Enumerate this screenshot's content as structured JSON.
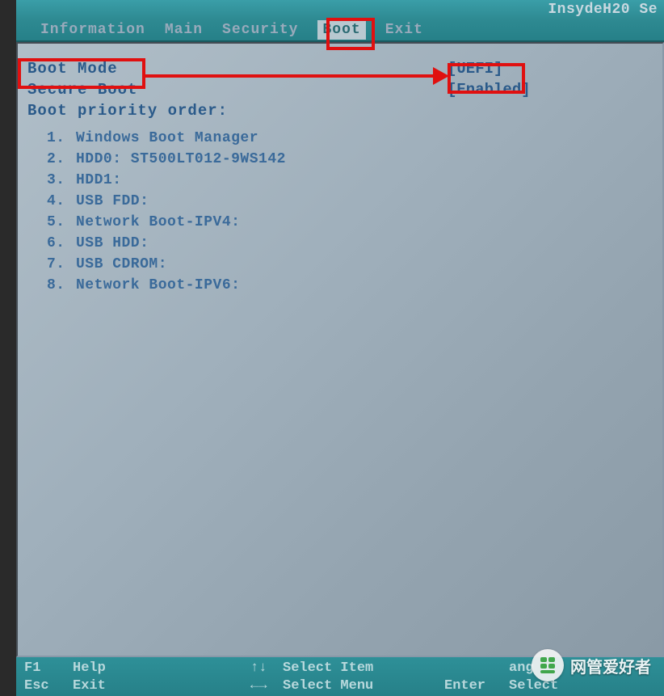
{
  "title_bar": "InsydeH20 Se",
  "menu": {
    "items": [
      "Information",
      "Main",
      "Security",
      "Boot",
      "Exit"
    ],
    "selected_index": 3
  },
  "settings": {
    "boot_mode": {
      "label": "Boot Mode",
      "value": "[UEFI]"
    },
    "secure_boot": {
      "label": "Secure Boot",
      "value": "[Enabled]"
    }
  },
  "boot_priority": {
    "title": "Boot priority order:",
    "items": [
      {
        "num": "1.",
        "label": "Windows Boot Manager"
      },
      {
        "num": "2.",
        "label": "HDD0: ST500LT012-9WS142"
      },
      {
        "num": "3.",
        "label": "HDD1:"
      },
      {
        "num": "4.",
        "label": "USB FDD:"
      },
      {
        "num": "5.",
        "label": "Network Boot-IPV4:"
      },
      {
        "num": "6.",
        "label": "USB HDD:"
      },
      {
        "num": "7.",
        "label": "USB CDROM:"
      },
      {
        "num": "8.",
        "label": "Network Boot-IPV6:"
      }
    ]
  },
  "footer": {
    "rows": [
      {
        "key": "F1",
        "label": "Help",
        "arrows": "↑↓",
        "label2": "Select Item",
        "key2": "",
        "label3": "ang"
      },
      {
        "key": "Esc",
        "label": "Exit",
        "arrows": "←→",
        "label2": "Select Menu",
        "key2": "Enter",
        "label3": "Select"
      }
    ]
  },
  "watermark": {
    "text": "网管爱好者"
  },
  "annotations": {
    "boxes": [
      "boot-tab",
      "boot-mode",
      "uefi-value"
    ],
    "arrow": true
  }
}
